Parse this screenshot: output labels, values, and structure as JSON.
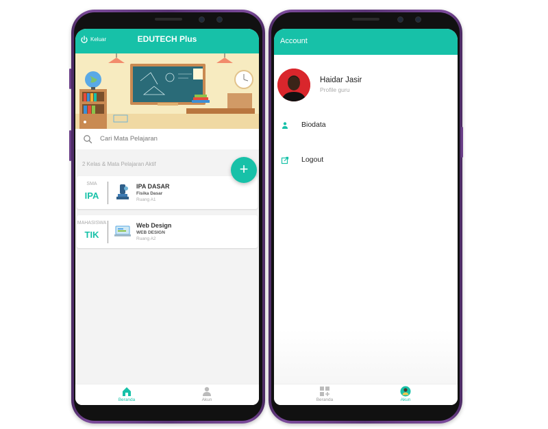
{
  "left_screen": {
    "header": {
      "logout_label": "Keluar",
      "title": "EDUTECH Plus"
    },
    "search": {
      "placeholder": "Cari Mata Pelajaran"
    },
    "section_label": "2 Kelas & Mata Pelajaran Aktif",
    "fab_icon": "plus-icon",
    "classes": [
      {
        "category": "SMA",
        "code": "IPA",
        "title": "IPA DASAR",
        "subtitle": "Fisika Dasar",
        "room": "Ruang A1"
      },
      {
        "category": "MAHASISWA",
        "code": "TIK",
        "title": "Web Design",
        "subtitle": "WEB DESIGN",
        "room": "Ruang A2"
      }
    ],
    "bottom_nav": [
      {
        "label": "Beranda",
        "icon": "home-icon",
        "active": true
      },
      {
        "label": "Akun",
        "icon": "person-icon",
        "active": false
      }
    ]
  },
  "right_screen": {
    "header": {
      "title": "Account"
    },
    "profile": {
      "name": "Haidar Jasir",
      "role": "Profile guru"
    },
    "menu": [
      {
        "label": "Biodata",
        "icon": "person-icon"
      },
      {
        "label": "Logout",
        "icon": "external-link-icon"
      }
    ],
    "bottom_nav": [
      {
        "label": "Beranda",
        "icon": "grid-add-icon",
        "active": false
      },
      {
        "label": "Akun",
        "icon": "person-icon",
        "active": true
      }
    ]
  },
  "colors": {
    "accent": "#17c1a8",
    "phone_frame": "#5b3577",
    "avatar_bg": "#d9262c"
  }
}
